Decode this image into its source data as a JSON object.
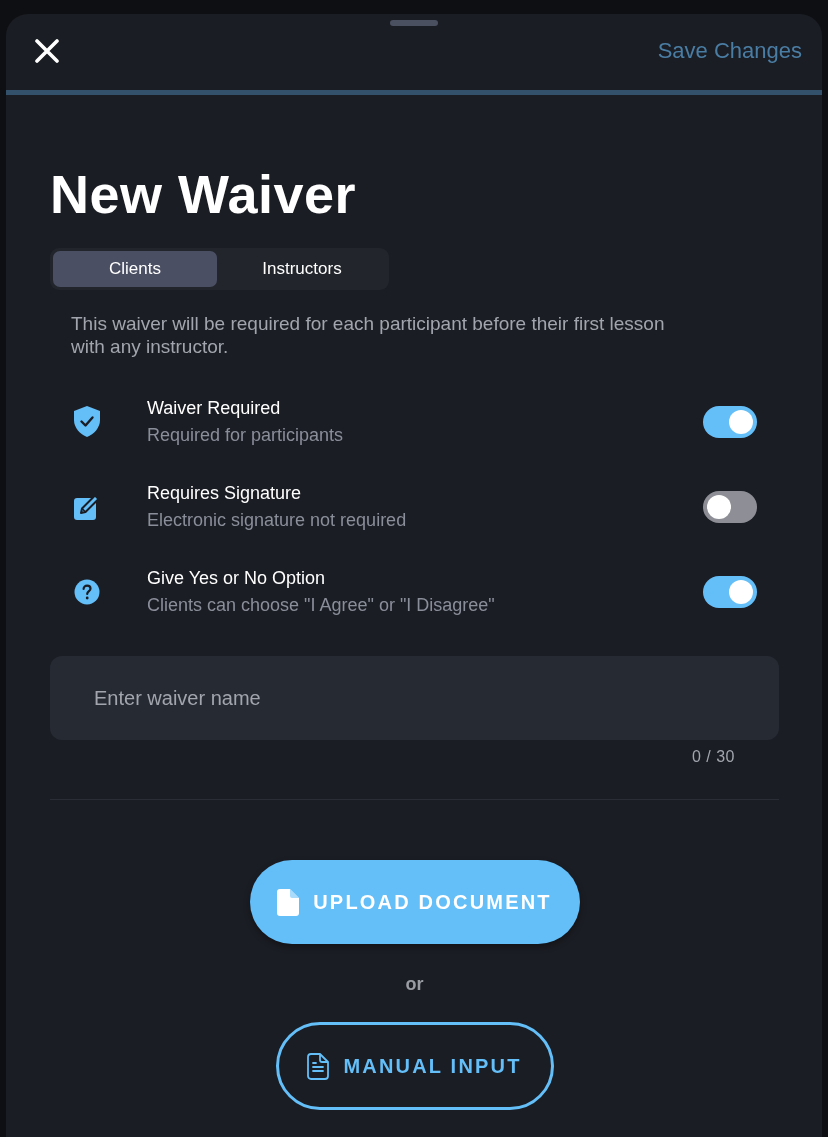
{
  "header": {
    "action": "Save Changes"
  },
  "title": "New Waiver",
  "tabs": [
    {
      "label": "Clients",
      "selected": true
    },
    {
      "label": "Instructors",
      "selected": false
    }
  ],
  "description": "This waiver will be required for each participant before their first lesson with any instructor.",
  "settings": [
    {
      "kind": "shield",
      "title": "Waiver Required",
      "subtitle": "Required for participants",
      "on": true
    },
    {
      "kind": "edit",
      "title": "Requires Signature",
      "subtitle": "Electronic signature not required",
      "on": false
    },
    {
      "kind": "question",
      "title": "Give Yes or No Option",
      "subtitle": "Clients can choose \"I Agree\" or \"I Disagree\"",
      "on": true
    }
  ],
  "name_field": {
    "placeholder": "Enter waiver name",
    "counter": "0 / 30"
  },
  "actions": [
    {
      "kind": "filled",
      "label": "UPLOAD DOCUMENT"
    },
    {
      "kind": "outlined",
      "label": "MANUAL INPUT"
    }
  ],
  "separator": "or"
}
